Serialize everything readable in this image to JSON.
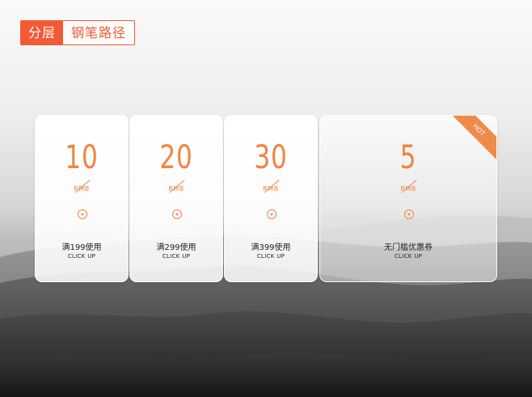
{
  "tag": {
    "left": "分层",
    "right": "钢笔路径"
  },
  "coupons": [
    {
      "amount": "10",
      "unit": "RMB",
      "condition": "满199使用",
      "cta": "CLICK UP"
    },
    {
      "amount": "20",
      "unit": "RMB",
      "condition": "满299使用",
      "cta": "CLICK UP"
    },
    {
      "amount": "30",
      "unit": "RMB",
      "condition": "满399使用",
      "cta": "CLICK UP"
    },
    {
      "amount": "5",
      "unit": "RMB",
      "condition": "无门槛优惠券",
      "cta": "CLICK UP",
      "badge": "HOT"
    }
  ],
  "colors": {
    "accent": "#ef8540",
    "tag_red": "#f25a35"
  }
}
